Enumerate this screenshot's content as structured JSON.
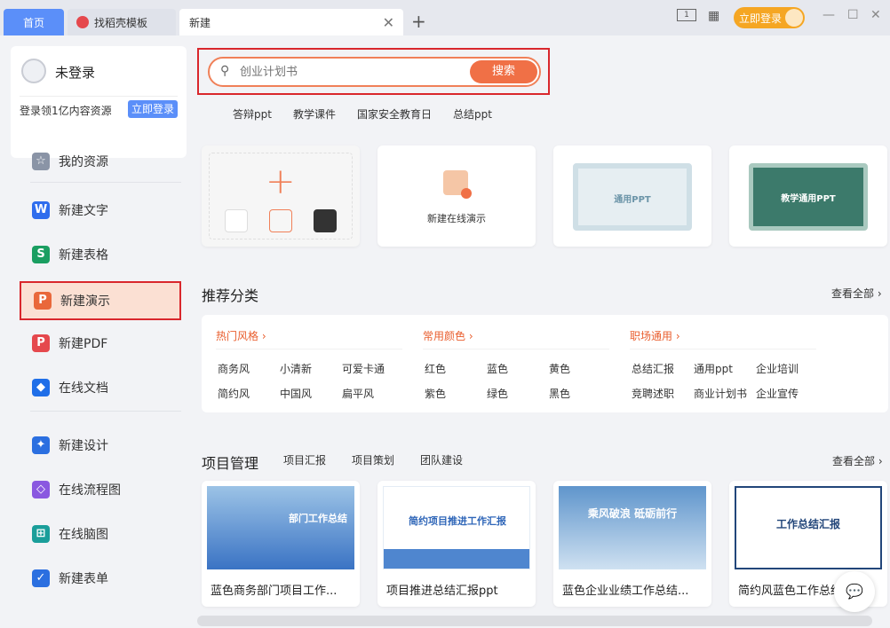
{
  "tabs": {
    "home": "首页",
    "daoke": "找稻壳模板",
    "new": "新建"
  },
  "topbar": {
    "login": "立即登录"
  },
  "user": {
    "name": "未登录",
    "promo": "登录领1亿内容资源",
    "login_btn": "立即登录"
  },
  "nav": [
    {
      "label": "我的资源",
      "icon": "star-icon",
      "color": "#8a94a6"
    },
    {
      "label": "新建文字",
      "icon": "word-icon",
      "color": "#2f6ded"
    },
    {
      "label": "新建表格",
      "icon": "sheet-icon",
      "color": "#1a9e61"
    },
    {
      "label": "新建演示",
      "icon": "presentation-icon",
      "color": "#e9683b"
    },
    {
      "label": "新建PDF",
      "icon": "pdf-icon",
      "color": "#e5484d"
    },
    {
      "label": "在线文档",
      "icon": "online-doc-icon",
      "color": "#1f6ee8"
    },
    {
      "label": "新建设计",
      "icon": "design-icon",
      "color": "#2b6fe0"
    },
    {
      "label": "在线流程图",
      "icon": "flowchart-icon",
      "color": "#8a58e0"
    },
    {
      "label": "在线脑图",
      "icon": "mindmap-icon",
      "color": "#1a9e9a"
    },
    {
      "label": "新建表单",
      "icon": "form-icon",
      "color": "#2b6fe0"
    }
  ],
  "search": {
    "placeholder": "创业计划书",
    "button": "搜索",
    "hotwords": [
      "答辩ppt",
      "教学课件",
      "国家安全教育日",
      "总结ppt"
    ]
  },
  "create_cards": {
    "online_label": "新建在线演示",
    "template1": "通用PPT",
    "template2": "教学通用PPT"
  },
  "recommend": {
    "title": "推荐分类",
    "view_all": "查看全部",
    "groups": [
      {
        "title": "热门风格",
        "items": [
          "商务风",
          "小清新",
          "可爱卡通",
          "简约风",
          "中国风",
          "扁平风"
        ]
      },
      {
        "title": "常用颜色",
        "items": [
          "红色",
          "蓝色",
          "黄色",
          "紫色",
          "绿色",
          "黑色"
        ]
      },
      {
        "title": "职场通用",
        "items": [
          "总结汇报",
          "通用ppt",
          "企业培训",
          "竞聘述职",
          "商业计划书",
          "企业宣传"
        ]
      }
    ]
  },
  "project": {
    "title": "项目管理",
    "tabs": [
      "项目汇报",
      "项目策划",
      "团队建设"
    ],
    "view_all": "查看全部",
    "cards": [
      {
        "title": "蓝色商务部门项目工作...",
        "thumb_text": "部门工作总结"
      },
      {
        "title": "项目推进总结汇报ppt",
        "thumb_text": "简约项目推进工作汇报"
      },
      {
        "title": "蓝色企业业绩工作总结...",
        "thumb_text": "乘风破浪 砥砺前行"
      },
      {
        "title": "简约风蓝色工作总结",
        "thumb_text": "工作总结汇报"
      }
    ]
  },
  "colors": {
    "accent": "#f07046",
    "primary": "#5b8ff9",
    "highlight": "#d9272c"
  }
}
